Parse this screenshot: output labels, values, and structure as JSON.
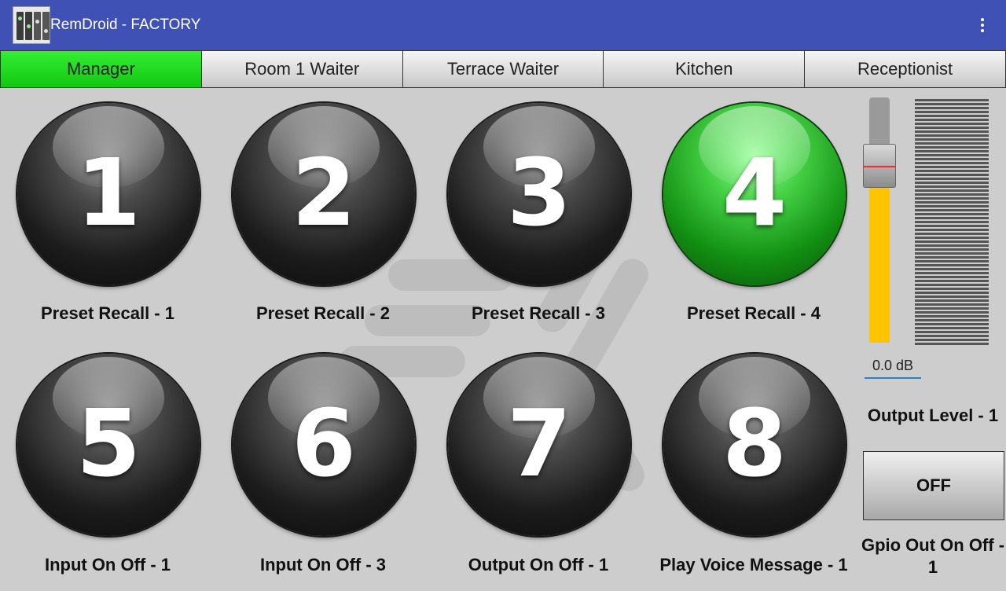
{
  "appbar": {
    "title": "RemDroid - FACTORY",
    "app_icon": "mixer-app-icon",
    "overflow_icon": "overflow-menu-icon"
  },
  "tabs": [
    {
      "label": "Manager",
      "active": true
    },
    {
      "label": "Room 1 Waiter",
      "active": false
    },
    {
      "label": "Terrace Waiter",
      "active": false
    },
    {
      "label": "Kitchen",
      "active": false
    },
    {
      "label": "Receptionist",
      "active": false
    }
  ],
  "buttons": [
    {
      "number": "1",
      "label": "Preset Recall - 1",
      "lit": false
    },
    {
      "number": "2",
      "label": "Preset Recall - 2",
      "lit": false
    },
    {
      "number": "3",
      "label": "Preset Recall - 3",
      "lit": false
    },
    {
      "number": "4",
      "label": "Preset Recall - 4",
      "lit": true
    },
    {
      "number": "5",
      "label": "Input On Off - 1",
      "lit": false
    },
    {
      "number": "6",
      "label": "Input On Off - 3",
      "lit": false
    },
    {
      "number": "7",
      "label": "Output On Off - 1",
      "lit": false
    },
    {
      "number": "8",
      "label": "Play Voice Message - 1",
      "lit": false
    }
  ],
  "output": {
    "db_value": "0.0 dB",
    "label": "Output Level - 1",
    "fader_level": 0.72
  },
  "gpio": {
    "button_label": "OFF",
    "label": "Gpio Out On Off - 1"
  },
  "colors": {
    "appbar": "#3f51b5",
    "active_tab": "#22dd22",
    "fader_fill": "#ffc400",
    "lit_button": "#2fc82f"
  }
}
